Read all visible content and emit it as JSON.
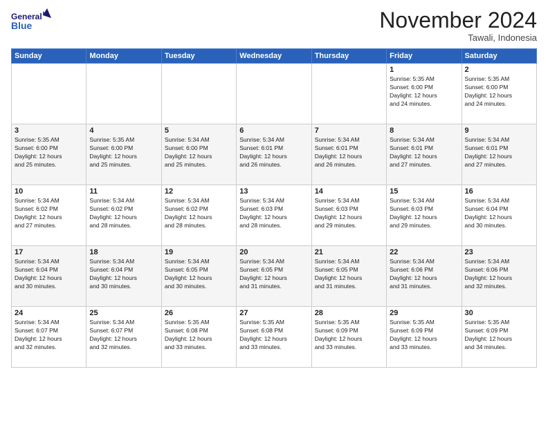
{
  "header": {
    "logo_line1": "General",
    "logo_line2": "Blue",
    "month": "November 2024",
    "location": "Tawali, Indonesia"
  },
  "days_of_week": [
    "Sunday",
    "Monday",
    "Tuesday",
    "Wednesday",
    "Thursday",
    "Friday",
    "Saturday"
  ],
  "weeks": [
    [
      {
        "day": "",
        "info": ""
      },
      {
        "day": "",
        "info": ""
      },
      {
        "day": "",
        "info": ""
      },
      {
        "day": "",
        "info": ""
      },
      {
        "day": "",
        "info": ""
      },
      {
        "day": "1",
        "info": "Sunrise: 5:35 AM\nSunset: 6:00 PM\nDaylight: 12 hours\nand 24 minutes."
      },
      {
        "day": "2",
        "info": "Sunrise: 5:35 AM\nSunset: 6:00 PM\nDaylight: 12 hours\nand 24 minutes."
      }
    ],
    [
      {
        "day": "3",
        "info": "Sunrise: 5:35 AM\nSunset: 6:00 PM\nDaylight: 12 hours\nand 25 minutes."
      },
      {
        "day": "4",
        "info": "Sunrise: 5:35 AM\nSunset: 6:00 PM\nDaylight: 12 hours\nand 25 minutes."
      },
      {
        "day": "5",
        "info": "Sunrise: 5:34 AM\nSunset: 6:00 PM\nDaylight: 12 hours\nand 25 minutes."
      },
      {
        "day": "6",
        "info": "Sunrise: 5:34 AM\nSunset: 6:01 PM\nDaylight: 12 hours\nand 26 minutes."
      },
      {
        "day": "7",
        "info": "Sunrise: 5:34 AM\nSunset: 6:01 PM\nDaylight: 12 hours\nand 26 minutes."
      },
      {
        "day": "8",
        "info": "Sunrise: 5:34 AM\nSunset: 6:01 PM\nDaylight: 12 hours\nand 27 minutes."
      },
      {
        "day": "9",
        "info": "Sunrise: 5:34 AM\nSunset: 6:01 PM\nDaylight: 12 hours\nand 27 minutes."
      }
    ],
    [
      {
        "day": "10",
        "info": "Sunrise: 5:34 AM\nSunset: 6:02 PM\nDaylight: 12 hours\nand 27 minutes."
      },
      {
        "day": "11",
        "info": "Sunrise: 5:34 AM\nSunset: 6:02 PM\nDaylight: 12 hours\nand 28 minutes."
      },
      {
        "day": "12",
        "info": "Sunrise: 5:34 AM\nSunset: 6:02 PM\nDaylight: 12 hours\nand 28 minutes."
      },
      {
        "day": "13",
        "info": "Sunrise: 5:34 AM\nSunset: 6:03 PM\nDaylight: 12 hours\nand 28 minutes."
      },
      {
        "day": "14",
        "info": "Sunrise: 5:34 AM\nSunset: 6:03 PM\nDaylight: 12 hours\nand 29 minutes."
      },
      {
        "day": "15",
        "info": "Sunrise: 5:34 AM\nSunset: 6:03 PM\nDaylight: 12 hours\nand 29 minutes."
      },
      {
        "day": "16",
        "info": "Sunrise: 5:34 AM\nSunset: 6:04 PM\nDaylight: 12 hours\nand 30 minutes."
      }
    ],
    [
      {
        "day": "17",
        "info": "Sunrise: 5:34 AM\nSunset: 6:04 PM\nDaylight: 12 hours\nand 30 minutes."
      },
      {
        "day": "18",
        "info": "Sunrise: 5:34 AM\nSunset: 6:04 PM\nDaylight: 12 hours\nand 30 minutes."
      },
      {
        "day": "19",
        "info": "Sunrise: 5:34 AM\nSunset: 6:05 PM\nDaylight: 12 hours\nand 30 minutes."
      },
      {
        "day": "20",
        "info": "Sunrise: 5:34 AM\nSunset: 6:05 PM\nDaylight: 12 hours\nand 31 minutes."
      },
      {
        "day": "21",
        "info": "Sunrise: 5:34 AM\nSunset: 6:05 PM\nDaylight: 12 hours\nand 31 minutes."
      },
      {
        "day": "22",
        "info": "Sunrise: 5:34 AM\nSunset: 6:06 PM\nDaylight: 12 hours\nand 31 minutes."
      },
      {
        "day": "23",
        "info": "Sunrise: 5:34 AM\nSunset: 6:06 PM\nDaylight: 12 hours\nand 32 minutes."
      }
    ],
    [
      {
        "day": "24",
        "info": "Sunrise: 5:34 AM\nSunset: 6:07 PM\nDaylight: 12 hours\nand 32 minutes."
      },
      {
        "day": "25",
        "info": "Sunrise: 5:34 AM\nSunset: 6:07 PM\nDaylight: 12 hours\nand 32 minutes."
      },
      {
        "day": "26",
        "info": "Sunrise: 5:35 AM\nSunset: 6:08 PM\nDaylight: 12 hours\nand 33 minutes."
      },
      {
        "day": "27",
        "info": "Sunrise: 5:35 AM\nSunset: 6:08 PM\nDaylight: 12 hours\nand 33 minutes."
      },
      {
        "day": "28",
        "info": "Sunrise: 5:35 AM\nSunset: 6:09 PM\nDaylight: 12 hours\nand 33 minutes."
      },
      {
        "day": "29",
        "info": "Sunrise: 5:35 AM\nSunset: 6:09 PM\nDaylight: 12 hours\nand 33 minutes."
      },
      {
        "day": "30",
        "info": "Sunrise: 5:35 AM\nSunset: 6:09 PM\nDaylight: 12 hours\nand 34 minutes."
      }
    ]
  ]
}
